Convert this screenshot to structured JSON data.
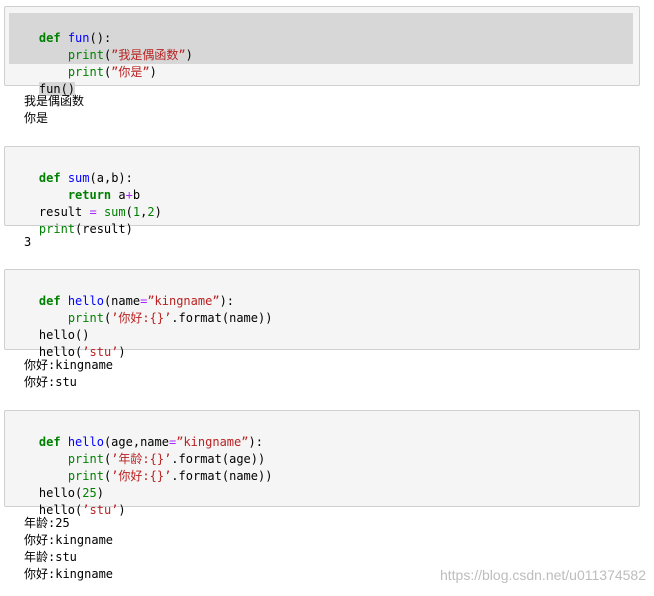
{
  "cells": [
    {
      "code": {
        "c1_line1": [
          "def",
          " ",
          "fun",
          "():"
        ],
        "c1_line2": [
          "    ",
          "print",
          "(",
          "”我是偶函数”",
          ")"
        ],
        "c1_line3": [
          "    ",
          "print",
          "(",
          "”你是”",
          ")"
        ],
        "c1_line4": "fun()"
      },
      "output": [
        "我是偶函数",
        "你是"
      ]
    },
    {
      "code": {
        "c2_line1": [
          "def",
          " ",
          "sum",
          "(a,b):"
        ],
        "c2_line2": [
          "    ",
          "return",
          " a",
          "+",
          "b"
        ],
        "c2_line3": [
          "result ",
          "=",
          " ",
          "sum",
          "(",
          "1",
          ",",
          "2",
          ")"
        ],
        "c2_line4": [
          "print",
          "(result)"
        ]
      },
      "output": [
        "3"
      ]
    },
    {
      "code": {
        "c3_line1": [
          "def",
          " ",
          "hello",
          "(name",
          "=",
          "”kingname”",
          "):"
        ],
        "c3_line2": [
          "    ",
          "print",
          "(",
          "’你好:{}’",
          ".format(name))"
        ],
        "c3_line3": "hello()",
        "c3_line4": [
          "hello(",
          "’stu’",
          ")"
        ]
      },
      "output": [
        "你好:kingname",
        "你好:stu"
      ]
    },
    {
      "code": {
        "c4_line1": [
          "def",
          " ",
          "hello",
          "(age,name",
          "=",
          "”kingname”",
          "):"
        ],
        "c4_line2": [
          "    ",
          "print",
          "(",
          "’年龄:{}’",
          ".format(age))"
        ],
        "c4_line3": [
          "    ",
          "print",
          "(",
          "’你好:{}’",
          ".format(name))"
        ],
        "c4_line4": [
          "hello(",
          "25",
          ")"
        ],
        "c4_line5": [
          "hello(",
          "’stu’",
          ")"
        ]
      },
      "output": [
        "年龄:25",
        "你好:kingname",
        "年龄:stu",
        "你好:kingname"
      ]
    }
  ],
  "watermark": "https://blog.csdn.net/u011374582",
  "colors": {
    "keyword": "#008000",
    "function_name": "#0000ff",
    "string": "#ba2121",
    "operator": "#aa22ff",
    "cell_background": "#f5f5f5",
    "selection": "#d7d7d7"
  }
}
